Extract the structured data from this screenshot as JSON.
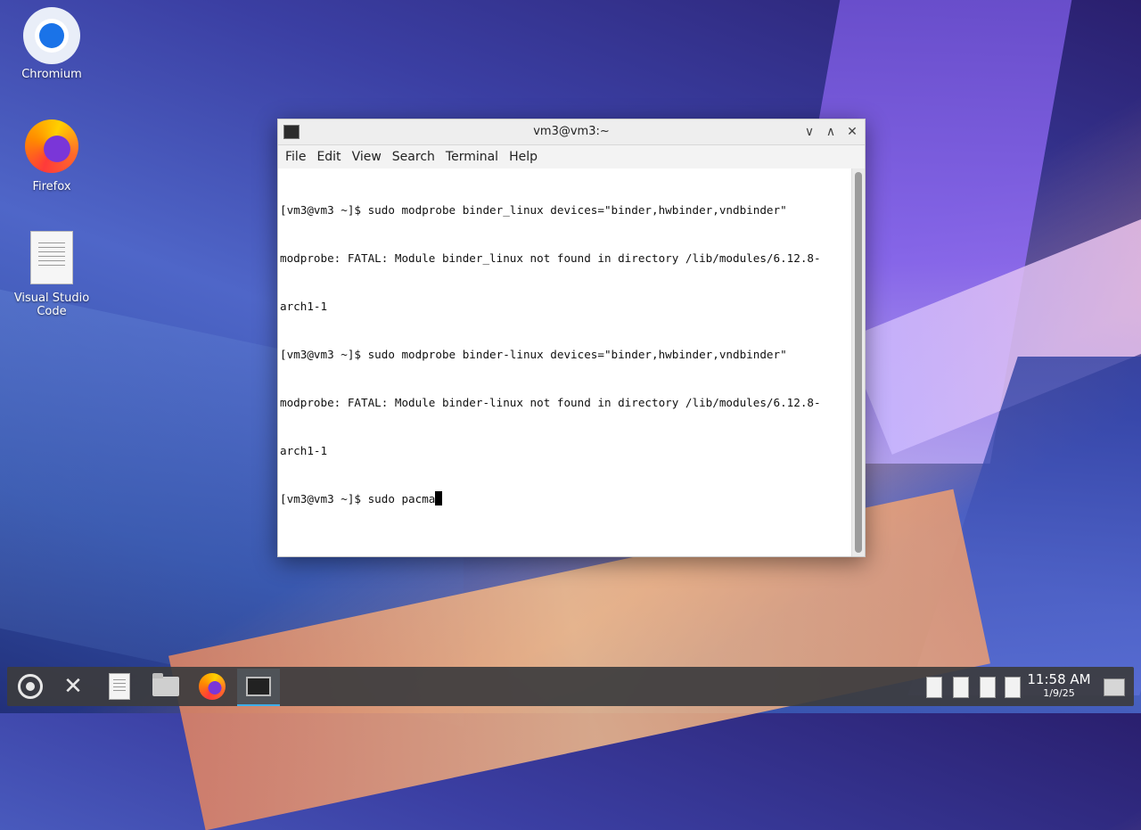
{
  "desktop": {
    "icons": [
      {
        "label": "Chromium"
      },
      {
        "label": "Firefox"
      },
      {
        "label": "Visual Studio Code"
      }
    ]
  },
  "window": {
    "title": "vm3@vm3:~",
    "menu": [
      "File",
      "Edit",
      "View",
      "Search",
      "Terminal",
      "Help"
    ],
    "controls": {
      "minimize": "∨",
      "maximize": "∧",
      "close": "✕"
    }
  },
  "terminal": {
    "lines": [
      "[vm3@vm3 ~]$ sudo modprobe binder_linux devices=\"binder,hwbinder,vndbinder\"",
      "modprobe: FATAL: Module binder_linux not found in directory /lib/modules/6.12.8-",
      "arch1-1",
      "[vm3@vm3 ~]$ sudo modprobe binder-linux devices=\"binder,hwbinder,vndbinder\"",
      "modprobe: FATAL: Module binder-linux not found in directory /lib/modules/6.12.8-",
      "arch1-1"
    ],
    "current_input": "[vm3@vm3 ~]$ sudo pacma"
  },
  "taskbar": {
    "clock_time": "11:58 AM",
    "clock_date": "1/9/25",
    "accent_color": "#3daee9"
  }
}
